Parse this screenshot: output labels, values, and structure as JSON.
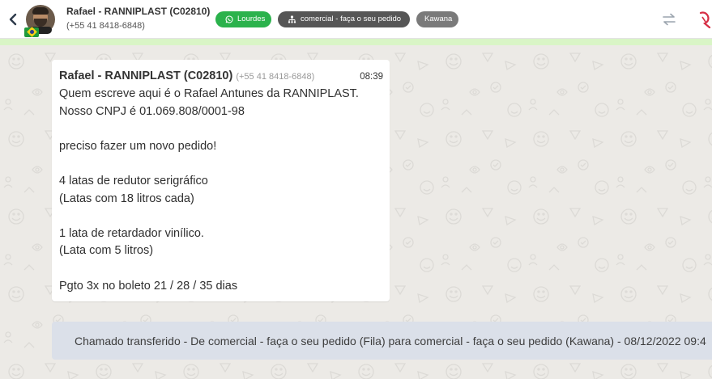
{
  "header": {
    "contact_name": "Rafael - RANNIPLAST (C02810)",
    "contact_phone": "(+55 41 8418-6848)",
    "tags": [
      {
        "label": "Lourdes",
        "icon": "whatsapp-icon",
        "color": "#2bb24c"
      },
      {
        "label": "comercial - faça o seu pedido",
        "icon": "sitemap-icon",
        "color": "#565656"
      },
      {
        "label": "Kawana",
        "icon": "",
        "color": "#7a7a7a"
      }
    ],
    "icons": [
      "back-icon",
      "transfer-icon",
      "logo-icon"
    ]
  },
  "message": {
    "sender": "Rafael - RANNIPLAST (C02810)",
    "phone": "(+55 41 8418-6848)",
    "time": "08:39",
    "lines": [
      "Quem escreve aqui é o Rafael Antunes da RANNIPLAST.",
      "Nosso CNPJ é 01.069.808/0001-98",
      "",
      "preciso fazer um novo pedido!",
      "",
      "4 latas de redutor serigráfico",
      "(Latas com 18 litros cada)",
      "",
      "1 lata de retardador vinílico.",
      "(Lata com 5 litros)",
      "",
      "Pgto 3x no boleto 21 / 28 / 35 dias"
    ]
  },
  "system_message": "Chamado transferido - De comercial - faça o seu pedido (Fila) para comercial - faça o seu pedido (Kawana) - 08/12/2022 09:4",
  "colors": {
    "accent_green": "#2bb24c",
    "strip": "#d9f5c6",
    "chat_bg": "#eceae6",
    "system_bg": "#dbe0e9"
  }
}
